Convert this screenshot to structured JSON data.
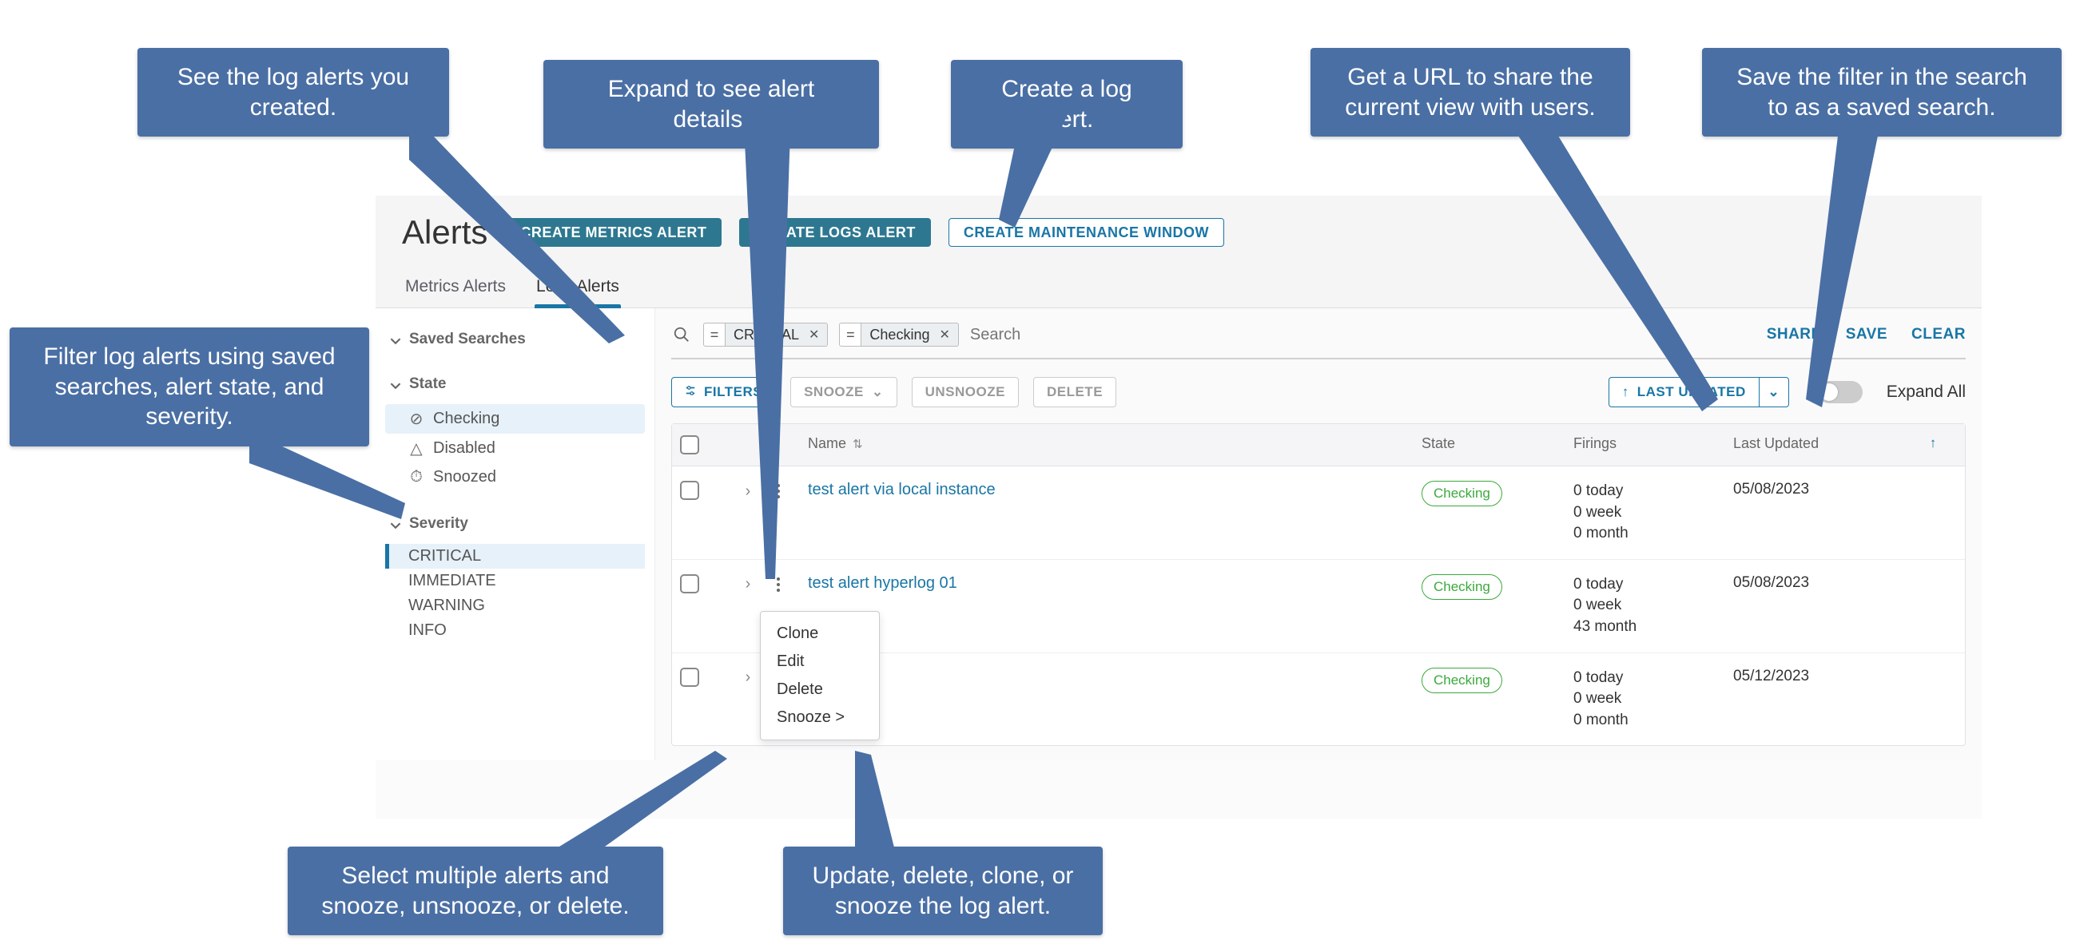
{
  "header": {
    "title": "Alerts",
    "buttons": {
      "create_metrics": "Create Metrics Alert",
      "create_logs": "Create Logs Alert",
      "create_maint": "Create Maintenance Window"
    },
    "tabs": {
      "metrics": "Metrics Alerts",
      "logs": "Logs Alerts"
    }
  },
  "sidebar": {
    "saved_searches": {
      "title": "Saved Searches"
    },
    "state": {
      "title": "State",
      "items": [
        {
          "icon": "⊘",
          "label": "Checking",
          "selected": true
        },
        {
          "icon": "△",
          "label": "Disabled",
          "selected": false
        },
        {
          "icon": "⏱",
          "label": "Snoozed",
          "selected": false
        }
      ]
    },
    "severity": {
      "title": "Severity",
      "items": [
        {
          "label": "CRITICAL",
          "selected": true
        },
        {
          "label": "IMMEDIATE",
          "selected": false
        },
        {
          "label": "WARNING",
          "selected": false
        },
        {
          "label": "INFO",
          "selected": false
        }
      ]
    }
  },
  "search": {
    "chips": [
      {
        "eq": "=",
        "value": "CRITICAL"
      },
      {
        "eq": "=",
        "value": "Checking"
      }
    ],
    "placeholder": "Search",
    "actions": {
      "share": "Share",
      "save": "Save",
      "clear": "Clear"
    }
  },
  "toolbar": {
    "filters": "Filters",
    "snooze": "Snooze",
    "unsnooze": "Unsnooze",
    "delete": "Delete",
    "sort": "Last Updated",
    "expand_all": "Expand All"
  },
  "table": {
    "columns": {
      "name": "Name",
      "state": "State",
      "firings": "Firings",
      "last_updated": "Last Updated"
    },
    "rows": [
      {
        "name": "test alert via local instance",
        "state": "Checking",
        "today": "0 today",
        "week": "0 week",
        "month": "0 month",
        "updated": "05/08/2023"
      },
      {
        "name": "test alert hyperlog 01",
        "state": "Checking",
        "today": "0 today",
        "week": "0 week",
        "month": "43 month",
        "updated": "05/08/2023"
      },
      {
        "name": "",
        "state": "Checking",
        "today": "0 today",
        "week": "0 week",
        "month": "0 month",
        "updated": "05/12/2023"
      }
    ]
  },
  "context_menu": {
    "clone": "Clone",
    "edit": "Edit",
    "delete": "Delete",
    "snooze": "Snooze >"
  },
  "callouts": {
    "created": "See the log alerts you created.",
    "expand": "Expand to see alert details.",
    "create": "Create a log alert.",
    "share": "Get a URL to share the current view with users.",
    "save": "Save the filter in the search to as a saved search.",
    "filter": "Filter log alerts using saved searches, alert state, and severity.",
    "select": "Select multiple alerts and snooze, unsnooze, or delete.",
    "update": "Update, delete, clone, or snooze the log alert."
  }
}
